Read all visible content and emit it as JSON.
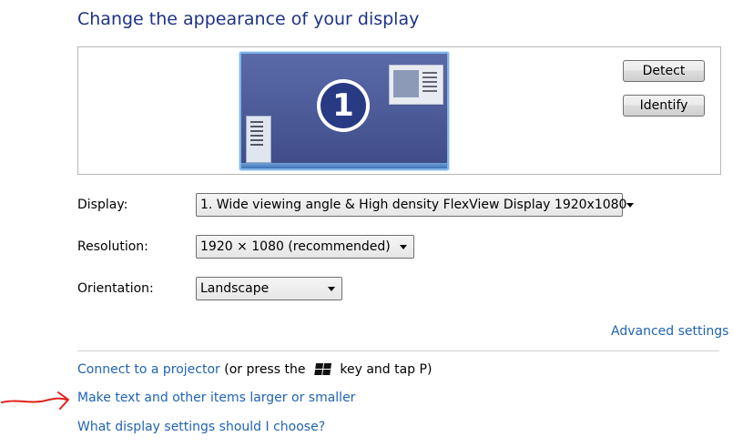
{
  "page": {
    "title": "Change the appearance of your display"
  },
  "preview": {
    "monitor_number": "1",
    "detect_label": "Detect",
    "identify_label": "Identify"
  },
  "settings": {
    "display_label": "Display:",
    "display_value": "1. Wide viewing angle & High density FlexView Display 1920x1080",
    "resolution_label": "Resolution:",
    "resolution_value": "1920 × 1080 (recommended)",
    "orientation_label": "Orientation:",
    "orientation_value": "Landscape"
  },
  "links": {
    "advanced": "Advanced settings",
    "projector": "Connect to a projector",
    "projector_hint_prefix": " (or press the ",
    "projector_hint_suffix": " key and tap P)",
    "text_size": "Make text and other items larger or smaller",
    "which_settings": "What display settings should I choose?"
  },
  "icons": {
    "windows_key": "windows-logo-icon",
    "dropdown": "chevron-down-icon",
    "annotation": "red-hand-drawn-arrow"
  },
  "colors": {
    "title": "#1e3287",
    "link": "#1f63b4",
    "annotation": "#e0201a"
  }
}
